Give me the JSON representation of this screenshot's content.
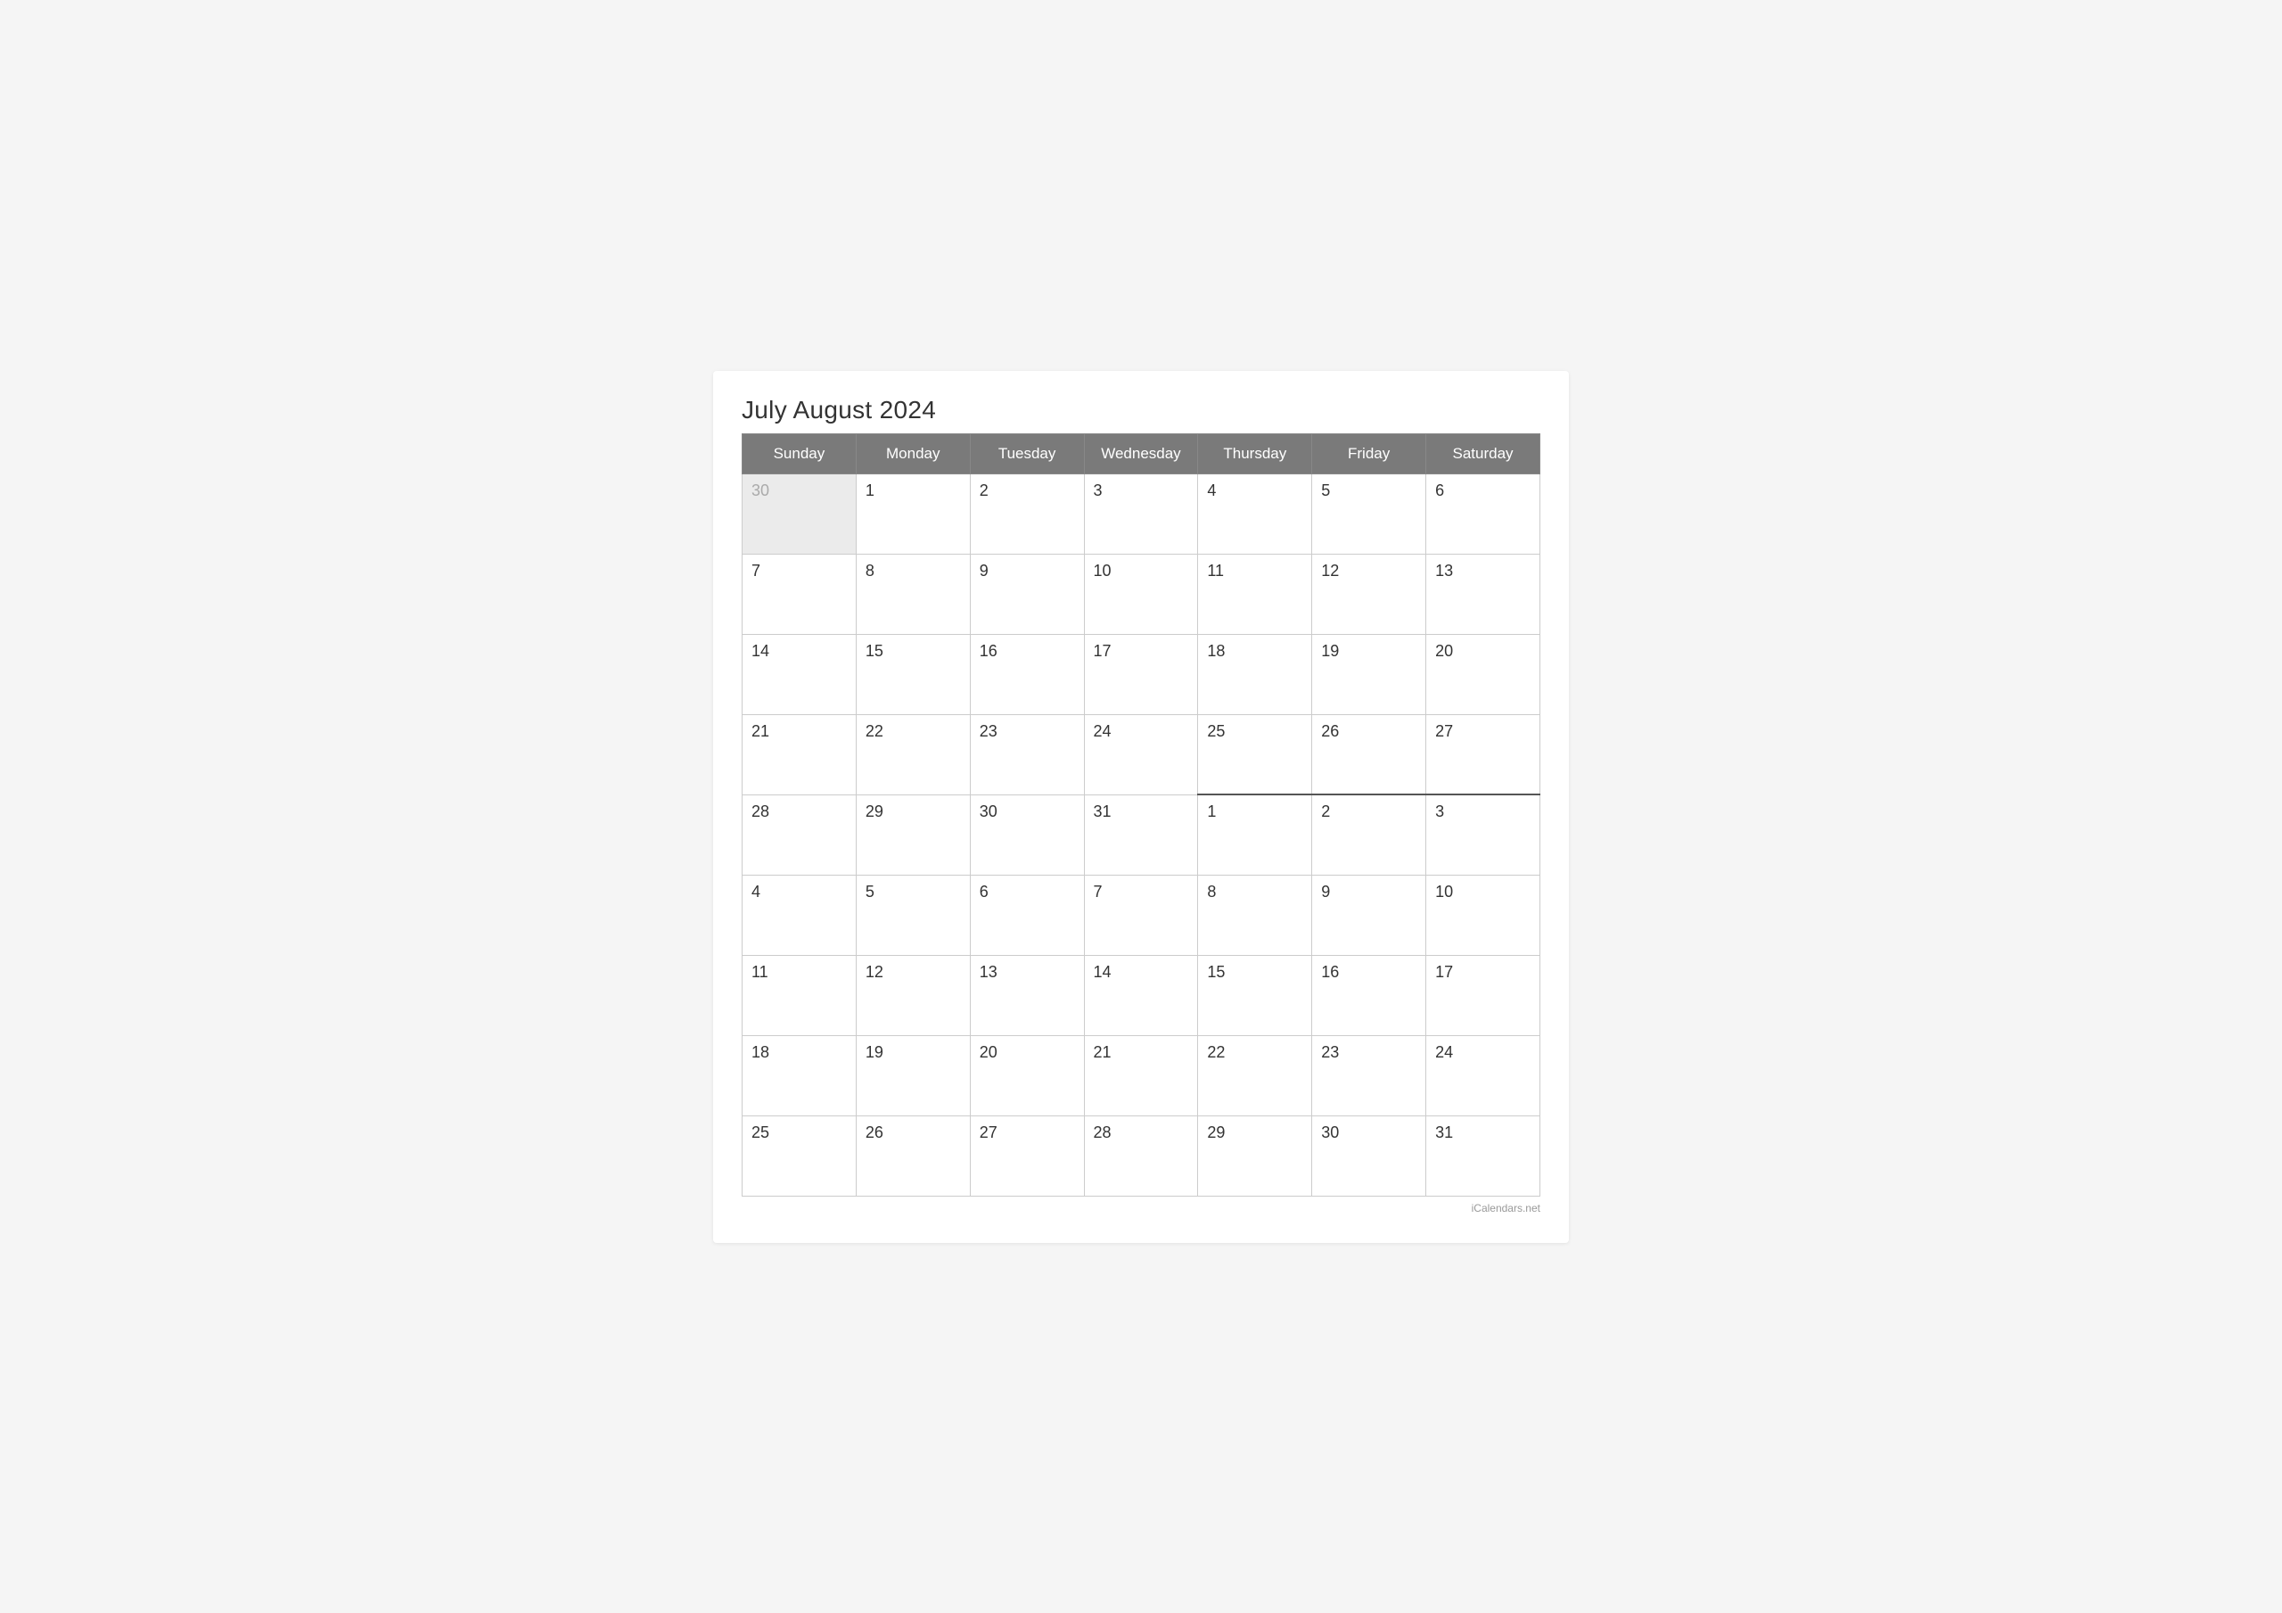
{
  "title": "July August 2024",
  "header": {
    "days": [
      "Sunday",
      "Monday",
      "Tuesday",
      "Wednesday",
      "Thursday",
      "Friday",
      "Saturday"
    ]
  },
  "rows": [
    {
      "cells": [
        {
          "day": "30",
          "outside": true
        },
        {
          "day": "1",
          "outside": false
        },
        {
          "day": "2",
          "outside": false
        },
        {
          "day": "3",
          "outside": false
        },
        {
          "day": "4",
          "outside": false
        },
        {
          "day": "5",
          "outside": false
        },
        {
          "day": "6",
          "outside": false
        }
      ]
    },
    {
      "cells": [
        {
          "day": "7",
          "outside": false
        },
        {
          "day": "8",
          "outside": false
        },
        {
          "day": "9",
          "outside": false
        },
        {
          "day": "10",
          "outside": false
        },
        {
          "day": "11",
          "outside": false
        },
        {
          "day": "12",
          "outside": false
        },
        {
          "day": "13",
          "outside": false
        }
      ]
    },
    {
      "cells": [
        {
          "day": "14",
          "outside": false
        },
        {
          "day": "15",
          "outside": false
        },
        {
          "day": "16",
          "outside": false
        },
        {
          "day": "17",
          "outside": false
        },
        {
          "day": "18",
          "outside": false
        },
        {
          "day": "19",
          "outside": false
        },
        {
          "day": "20",
          "outside": false
        }
      ]
    },
    {
      "cells": [
        {
          "day": "21",
          "outside": false
        },
        {
          "day": "22",
          "outside": false
        },
        {
          "day": "23",
          "outside": false
        },
        {
          "day": "24",
          "outside": false
        },
        {
          "day": "25",
          "outside": false
        },
        {
          "day": "26",
          "outside": false
        },
        {
          "day": "27",
          "outside": false
        }
      ]
    },
    {
      "cells": [
        {
          "day": "28",
          "outside": false,
          "month": "july"
        },
        {
          "day": "29",
          "outside": false,
          "month": "july"
        },
        {
          "day": "30",
          "outside": false,
          "month": "july"
        },
        {
          "day": "31",
          "outside": false,
          "month": "july"
        },
        {
          "day": "1",
          "outside": false,
          "month": "august",
          "new_month": true
        },
        {
          "day": "2",
          "outside": false,
          "month": "august",
          "new_month": true
        },
        {
          "day": "3",
          "outside": false,
          "month": "august",
          "new_month": true
        }
      ]
    },
    {
      "cells": [
        {
          "day": "4",
          "outside": false
        },
        {
          "day": "5",
          "outside": false
        },
        {
          "day": "6",
          "outside": false
        },
        {
          "day": "7",
          "outside": false
        },
        {
          "day": "8",
          "outside": false
        },
        {
          "day": "9",
          "outside": false
        },
        {
          "day": "10",
          "outside": false
        }
      ]
    },
    {
      "cells": [
        {
          "day": "11",
          "outside": false
        },
        {
          "day": "12",
          "outside": false
        },
        {
          "day": "13",
          "outside": false
        },
        {
          "day": "14",
          "outside": false
        },
        {
          "day": "15",
          "outside": false
        },
        {
          "day": "16",
          "outside": false
        },
        {
          "day": "17",
          "outside": false
        }
      ]
    },
    {
      "cells": [
        {
          "day": "18",
          "outside": false
        },
        {
          "day": "19",
          "outside": false
        },
        {
          "day": "20",
          "outside": false
        },
        {
          "day": "21",
          "outside": false
        },
        {
          "day": "22",
          "outside": false
        },
        {
          "day": "23",
          "outside": false
        },
        {
          "day": "24",
          "outside": false
        }
      ]
    },
    {
      "cells": [
        {
          "day": "25",
          "outside": false
        },
        {
          "day": "26",
          "outside": false
        },
        {
          "day": "27",
          "outside": false
        },
        {
          "day": "28",
          "outside": false
        },
        {
          "day": "29",
          "outside": false
        },
        {
          "day": "30",
          "outside": false
        },
        {
          "day": "31",
          "outside": false
        }
      ]
    }
  ],
  "footer": {
    "text": "iCalendars.net"
  }
}
